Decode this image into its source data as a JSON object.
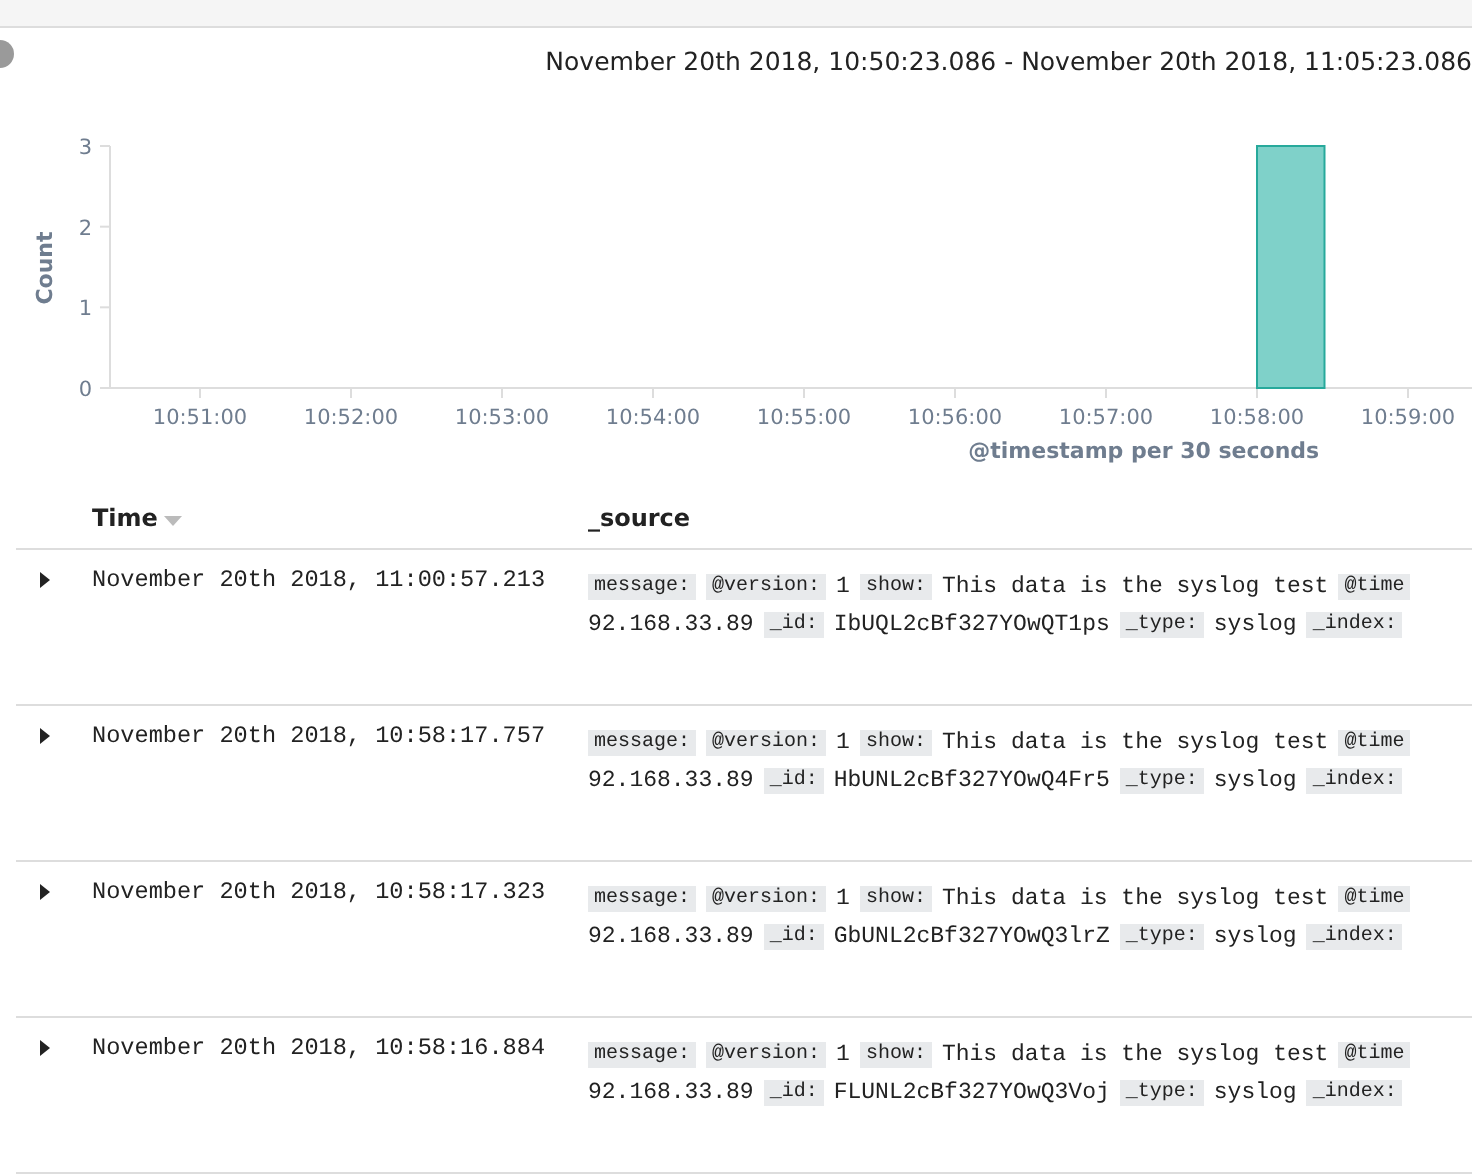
{
  "time_range": "November 20th 2018, 10:50:23.086 - November 20th 2018, 11:05:23.086",
  "chart": {
    "chart_data": {
      "type": "bar",
      "xlabel": "@timestamp per 30 seconds",
      "ylabel": "Count",
      "ylim": [
        0,
        3
      ],
      "yticks": [
        0,
        1,
        2,
        3
      ],
      "categories": [
        "10:51:00",
        null,
        "10:52:00",
        null,
        "10:53:00",
        null,
        "10:54:00",
        null,
        "10:55:00",
        null,
        "10:56:00",
        null,
        "10:57:00",
        null,
        "10:58:00",
        null,
        "10:59:00"
      ],
      "values": [
        null,
        null,
        null,
        null,
        null,
        null,
        null,
        null,
        null,
        null,
        null,
        null,
        null,
        null,
        3,
        null,
        null
      ]
    }
  },
  "table": {
    "columns": [
      "Time",
      "_source"
    ],
    "rows": [
      {
        "time": "November 20th 2018, 11:00:57.213",
        "expanded": false,
        "lines": [
          [
            {
              "kind": "key",
              "text": "message:"
            },
            {
              "kind": "key",
              "text": "@version:"
            },
            {
              "kind": "value",
              "text": "1"
            },
            {
              "kind": "key",
              "text": "show:"
            },
            {
              "kind": "value",
              "text": "This data is the syslog test"
            },
            {
              "kind": "key",
              "text": "@time"
            }
          ],
          [
            {
              "kind": "value",
              "text": "92.168.33.89"
            },
            {
              "kind": "key",
              "text": "_id:"
            },
            {
              "kind": "value",
              "text": "IbUQL2cBf327YOwQT1ps"
            },
            {
              "kind": "key",
              "text": "_type:"
            },
            {
              "kind": "value",
              "text": "syslog"
            },
            {
              "kind": "key",
              "text": "_index:"
            }
          ]
        ]
      },
      {
        "time": "November 20th 2018, 10:58:17.757",
        "expanded": false,
        "lines": [
          [
            {
              "kind": "key",
              "text": "message:"
            },
            {
              "kind": "key",
              "text": "@version:"
            },
            {
              "kind": "value",
              "text": "1"
            },
            {
              "kind": "key",
              "text": "show:"
            },
            {
              "kind": "value",
              "text": "This data is the syslog test"
            },
            {
              "kind": "key",
              "text": "@time"
            }
          ],
          [
            {
              "kind": "value",
              "text": "92.168.33.89"
            },
            {
              "kind": "key",
              "text": "_id:"
            },
            {
              "kind": "value",
              "text": "HbUNL2cBf327YOwQ4Fr5"
            },
            {
              "kind": "key",
              "text": "_type:"
            },
            {
              "kind": "value",
              "text": "syslog"
            },
            {
              "kind": "key",
              "text": "_index:"
            }
          ]
        ]
      },
      {
        "time": "November 20th 2018, 10:58:17.323",
        "expanded": false,
        "lines": [
          [
            {
              "kind": "key",
              "text": "message:"
            },
            {
              "kind": "key",
              "text": "@version:"
            },
            {
              "kind": "value",
              "text": "1"
            },
            {
              "kind": "key",
              "text": "show:"
            },
            {
              "kind": "value",
              "text": "This data is the syslog test"
            },
            {
              "kind": "key",
              "text": "@time"
            }
          ],
          [
            {
              "kind": "value",
              "text": "92.168.33.89"
            },
            {
              "kind": "key",
              "text": "_id:"
            },
            {
              "kind": "value",
              "text": "GbUNL2cBf327YOwQ3lrZ"
            },
            {
              "kind": "key",
              "text": "_type:"
            },
            {
              "kind": "value",
              "text": "syslog"
            },
            {
              "kind": "key",
              "text": "_index:"
            }
          ]
        ]
      },
      {
        "time": "November 20th 2018, 10:58:16.884",
        "expanded": false,
        "lines": [
          [
            {
              "kind": "key",
              "text": "message:"
            },
            {
              "kind": "key",
              "text": "@version:"
            },
            {
              "kind": "value",
              "text": "1"
            },
            {
              "kind": "key",
              "text": "show:"
            },
            {
              "kind": "value",
              "text": "This data is the syslog test"
            },
            {
              "kind": "key",
              "text": "@time"
            }
          ],
          [
            {
              "kind": "value",
              "text": "92.168.33.89"
            },
            {
              "kind": "key",
              "text": "_id:"
            },
            {
              "kind": "value",
              "text": "FLUNL2cBf327YOwQ3Voj"
            },
            {
              "kind": "key",
              "text": "_type:"
            },
            {
              "kind": "value",
              "text": "syslog"
            },
            {
              "kind": "key",
              "text": "_index:"
            }
          ]
        ]
      }
    ]
  }
}
